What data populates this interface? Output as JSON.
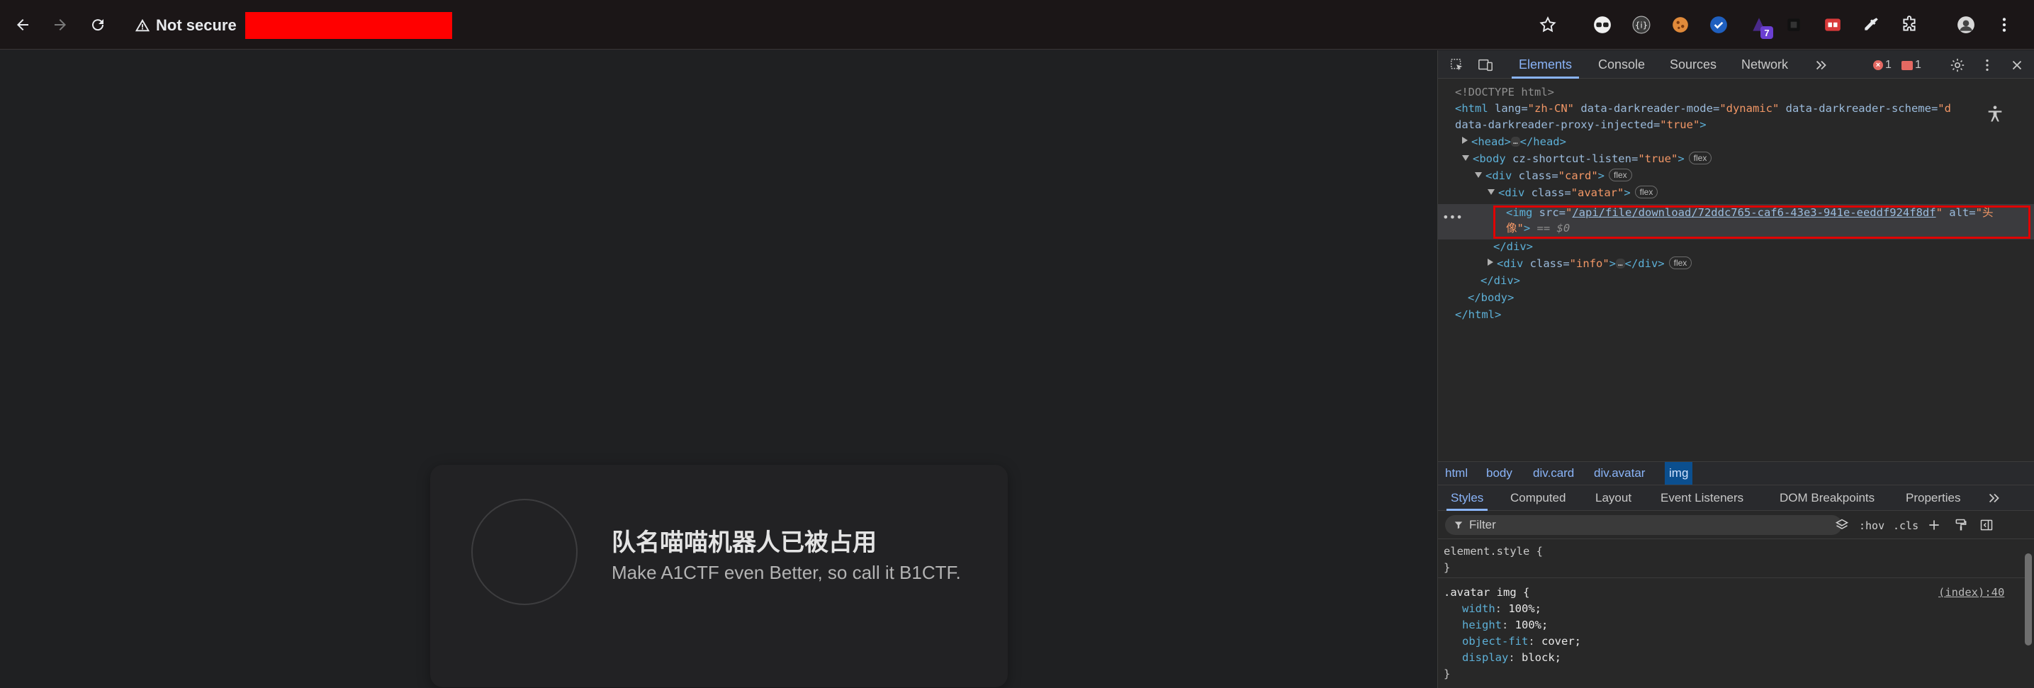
{
  "browser": {
    "security_label": "Not secure",
    "extension_badge": "7"
  },
  "page": {
    "team_title": "队名喵喵机器人已被占用",
    "subtitle": "Make A1CTF even Better, so call it B1CTF."
  },
  "devtools": {
    "tabs": [
      "Elements",
      "Console",
      "Sources",
      "Network"
    ],
    "error_count": "1",
    "message_count": "1",
    "dom": {
      "doctype": "<!DOCTYPE html>",
      "html_open": "<html",
      "html_lang_attr": " lang=",
      "html_lang_val": "\"zh-CN\"",
      "html_mode_attr": " data-darkreader-mode=",
      "html_mode_val": "\"dynamic\"",
      "html_scheme_attr": " data-darkreader-scheme=",
      "html_scheme_val": "\"d",
      "html_proxy_attr": "data-darkreader-proxy-injected=",
      "html_proxy_val": "\"true\"",
      "gt": ">",
      "head_open": "<head>",
      "head_close": "</head>",
      "ellipsis": "…",
      "body_open": "<body",
      "body_attr": " cz-shortcut-listen=",
      "body_val": "\"true\"",
      "flex": "flex",
      "div_open": "<div",
      "class_attr": " class=",
      "card_val": "\"card\"",
      "avatar_val": "\"avatar\"",
      "img_open": "<img",
      "src_attr": " src=",
      "src_q": "\"",
      "src_url": "/api/file/download/72ddc765-caf6-43e3-941e-eeddf924f8df",
      "alt_attr": " alt=",
      "alt_val_1": "\"头",
      "alt_val_2": "像\"",
      "eq_sel": " == $0",
      "div_close": "</div>",
      "info_val": "\"info\"",
      "body_close": "</body>",
      "html_close": "</html>",
      "row_dots": "•••"
    },
    "breadcrumbs": [
      "html",
      "body",
      "div.card",
      "div.avatar",
      "img"
    ],
    "sub_tabs": [
      "Styles",
      "Computed",
      "Layout",
      "Event Listeners",
      "DOM Breakpoints",
      "Properties"
    ],
    "filter_placeholder": "Filter",
    "hov": ":hov",
    "cls": ".cls",
    "styles": {
      "element_style": "element.style {",
      "close_brace": "}",
      "rule_selector": ".avatar img {",
      "rule_source": "(index):40",
      "props": [
        {
          "name": "width",
          "value": "100%;"
        },
        {
          "name": "height",
          "value": "100%;"
        },
        {
          "name": "object-fit",
          "value": "cover;"
        },
        {
          "name": "display",
          "value": "block;"
        }
      ],
      "colon": ": "
    }
  }
}
